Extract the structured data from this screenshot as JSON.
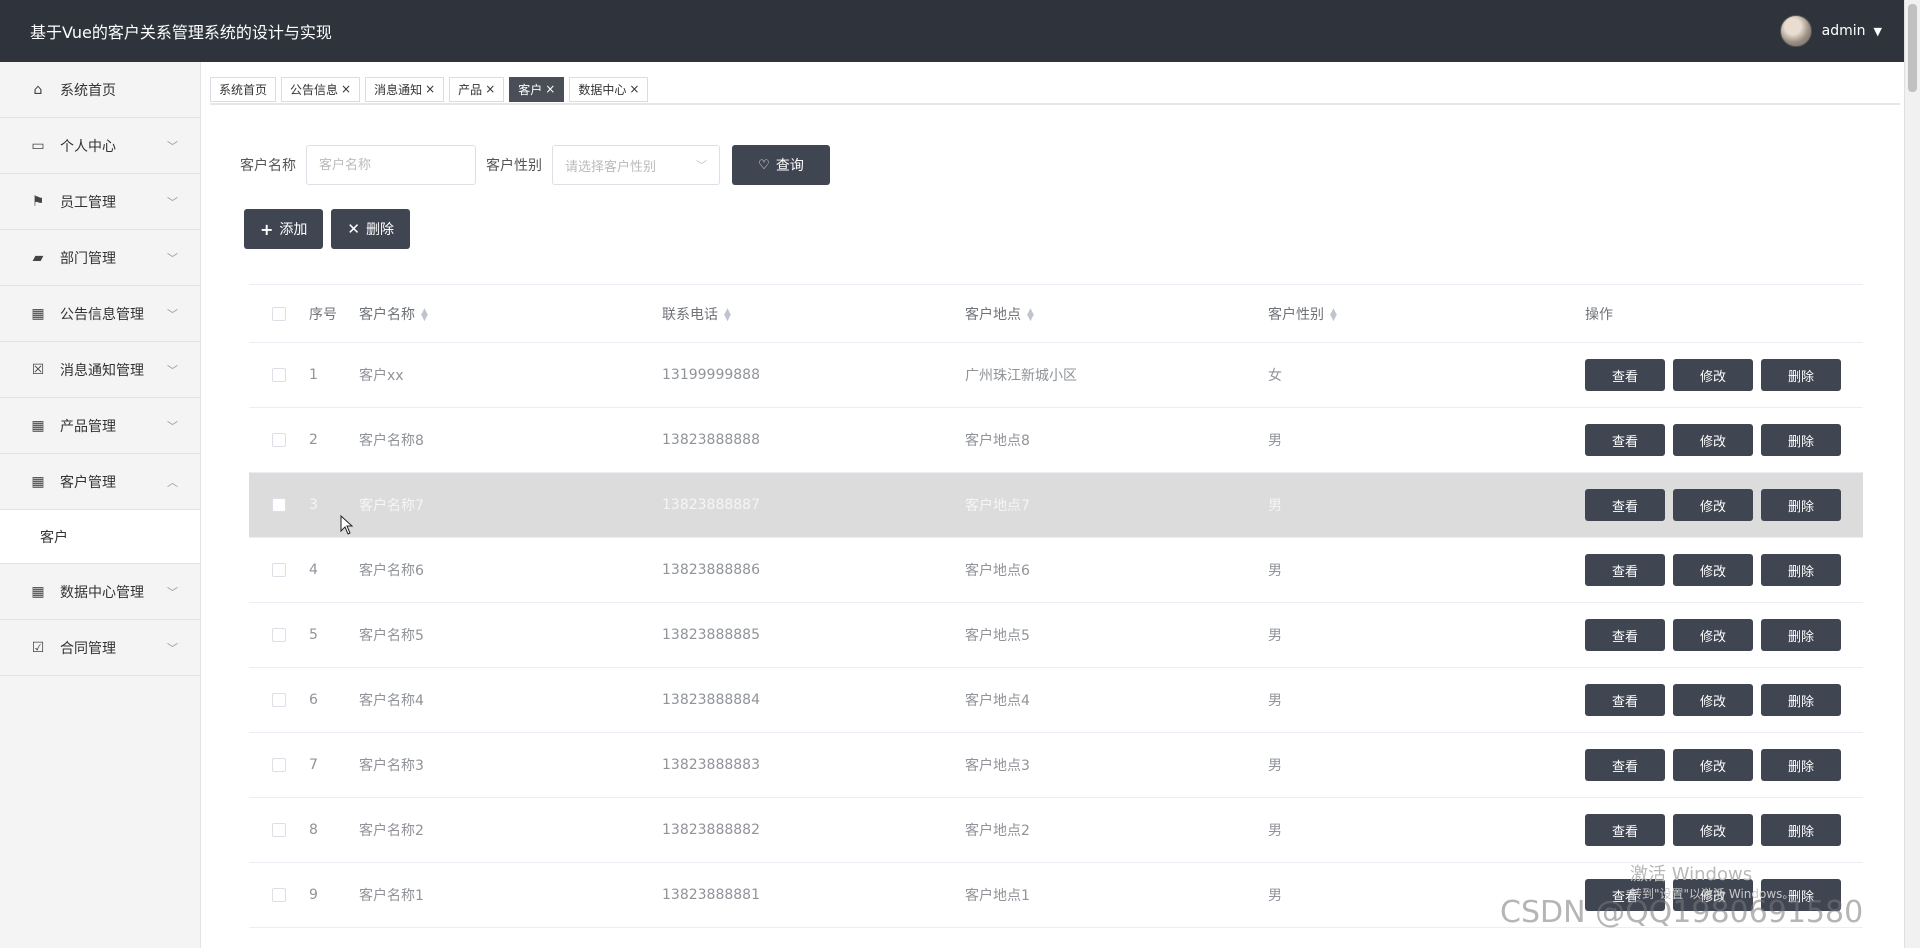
{
  "header": {
    "title": "基于Vue的客户关系管理系统的设计与实现",
    "username": "admin"
  },
  "sidebar": {
    "items": [
      {
        "label": "系统首页",
        "icon": "home-icon",
        "expandable": false
      },
      {
        "label": "个人中心",
        "icon": "card-icon",
        "expandable": true
      },
      {
        "label": "员工管理",
        "icon": "flag-icon",
        "expandable": true
      },
      {
        "label": "部门管理",
        "icon": "ticket-icon",
        "expandable": true
      },
      {
        "label": "公告信息管理",
        "icon": "grid-icon",
        "expandable": true
      },
      {
        "label": "消息通知管理",
        "icon": "clipboard-x-icon",
        "expandable": true
      },
      {
        "label": "产品管理",
        "icon": "grid-icon",
        "expandable": true
      },
      {
        "label": "客户管理",
        "icon": "grid-icon",
        "expandable": true,
        "expanded": true
      },
      {
        "label": "数据中心管理",
        "icon": "grid9-icon",
        "expandable": true
      },
      {
        "label": "合同管理",
        "icon": "clipboard-check-icon",
        "expandable": true
      }
    ],
    "submenu": {
      "label": "客户"
    }
  },
  "tabs": [
    {
      "label": "系统首页",
      "closable": false
    },
    {
      "label": "公告信息",
      "closable": true
    },
    {
      "label": "消息通知",
      "closable": true
    },
    {
      "label": "产品",
      "closable": true
    },
    {
      "label": "客户",
      "closable": true,
      "active": true
    },
    {
      "label": "数据中心",
      "closable": true
    }
  ],
  "search": {
    "name_label": "客户名称",
    "name_placeholder": "客户名称",
    "gender_label": "客户性别",
    "gender_placeholder": "请选择客户性别",
    "query_button": "查询"
  },
  "actions": {
    "add_button": "添加",
    "delete_button": "删除"
  },
  "table": {
    "columns": [
      "序号",
      "客户名称",
      "联系电话",
      "客户地点",
      "客户性别",
      "操作"
    ],
    "rows": [
      {
        "no": "1",
        "name": "客户xx",
        "phone": "13199999888",
        "address": "广州珠江新城小区",
        "gender": "女"
      },
      {
        "no": "2",
        "name": "客户名称8",
        "phone": "13823888888",
        "address": "客户地点8",
        "gender": "男"
      },
      {
        "no": "3",
        "name": "客户名称7",
        "phone": "13823888887",
        "address": "客户地点7",
        "gender": "男"
      },
      {
        "no": "4",
        "name": "客户名称6",
        "phone": "13823888886",
        "address": "客户地点6",
        "gender": "男"
      },
      {
        "no": "5",
        "name": "客户名称5",
        "phone": "13823888885",
        "address": "客户地点5",
        "gender": "男"
      },
      {
        "no": "6",
        "name": "客户名称4",
        "phone": "13823888884",
        "address": "客户地点4",
        "gender": "男"
      },
      {
        "no": "7",
        "name": "客户名称3",
        "phone": "13823888883",
        "address": "客户地点3",
        "gender": "男"
      },
      {
        "no": "8",
        "name": "客户名称2",
        "phone": "13823888882",
        "address": "客户地点2",
        "gender": "男"
      },
      {
        "no": "9",
        "name": "客户名称1",
        "phone": "13823888881",
        "address": "客户地点1",
        "gender": "男"
      }
    ],
    "row_actions": {
      "view": "查看",
      "edit": "修改",
      "delete": "删除"
    }
  },
  "watermarks": {
    "windows_title": "激活 Windows",
    "windows_sub": "转到\"设置\"以激活 Windows。",
    "csdn": "CSDN @QQ1980691580"
  }
}
